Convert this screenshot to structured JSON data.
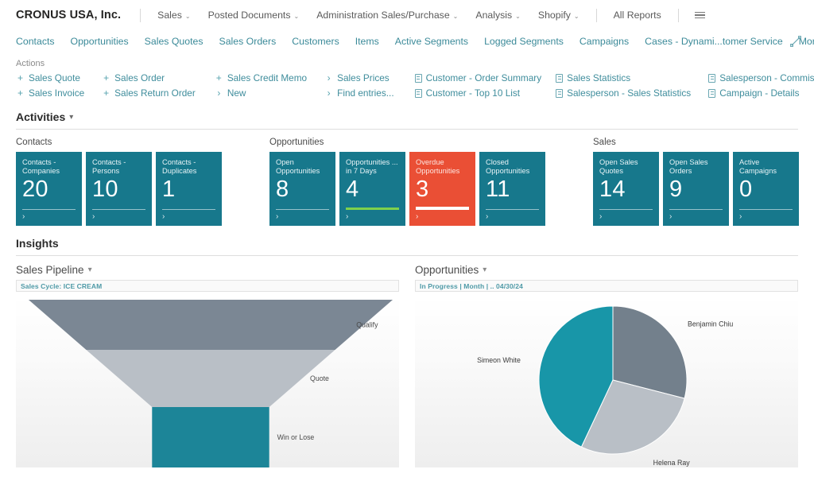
{
  "header": {
    "company": "CRONUS USA, Inc.",
    "nav": [
      {
        "label": "Sales",
        "caret": true
      },
      {
        "label": "Posted Documents",
        "caret": true
      },
      {
        "label": "Administration Sales/Purchase",
        "caret": true
      },
      {
        "label": "Analysis",
        "caret": true
      },
      {
        "label": "Shopify",
        "caret": true
      },
      {
        "label": "All Reports",
        "caret": false
      }
    ],
    "menu_icon": "hamburger-icon",
    "expand_icon": "expand-icon"
  },
  "tabs": [
    {
      "label": "Contacts",
      "caret": false
    },
    {
      "label": "Opportunities",
      "caret": false
    },
    {
      "label": "Sales Quotes",
      "caret": false
    },
    {
      "label": "Sales Orders",
      "caret": false
    },
    {
      "label": "Customers",
      "caret": false
    },
    {
      "label": "Items",
      "caret": false
    },
    {
      "label": "Active Segments",
      "caret": false
    },
    {
      "label": "Logged Segments",
      "caret": false
    },
    {
      "label": "Campaigns",
      "caret": false
    },
    {
      "label": "Cases - Dynami...tomer Service",
      "caret": false
    },
    {
      "label": "More",
      "caret": true
    }
  ],
  "actions": {
    "title": "Actions",
    "columns": [
      [
        {
          "icon": "plus-icon",
          "glyph": "+",
          "label": "Sales Quote"
        },
        {
          "icon": "plus-icon",
          "glyph": "+",
          "label": "Sales Invoice"
        }
      ],
      [
        {
          "icon": "plus-icon",
          "glyph": "+",
          "label": "Sales Order"
        },
        {
          "icon": "plus-icon",
          "glyph": "+",
          "label": "Sales Return Order"
        }
      ],
      [
        {
          "icon": "plus-icon",
          "glyph": "+",
          "label": "Sales Credit Memo"
        },
        {
          "icon": "chevron-right-icon",
          "glyph": "›",
          "label": "New"
        }
      ],
      [
        {
          "icon": "chevron-right-icon",
          "glyph": "›",
          "label": "Sales Prices"
        },
        {
          "icon": "chevron-right-icon",
          "glyph": "›",
          "label": "Find entries..."
        }
      ],
      [
        {
          "icon": "report-icon",
          "glyph": "",
          "label": "Customer - Order Summary"
        },
        {
          "icon": "report-icon",
          "glyph": "",
          "label": "Customer - Top 10 List"
        }
      ],
      [
        {
          "icon": "report-icon",
          "glyph": "",
          "label": "Sales Statistics"
        },
        {
          "icon": "report-icon",
          "glyph": "",
          "label": "Salesperson - Sales Statistics"
        }
      ],
      [
        {
          "icon": "report-icon",
          "glyph": "",
          "label": "Salesperson - Commission"
        },
        {
          "icon": "report-icon",
          "glyph": "",
          "label": "Campaign - Details"
        }
      ]
    ]
  },
  "activities": {
    "title": "Activities",
    "groups": [
      {
        "label": "Contacts",
        "tiles": [
          {
            "caption": "Contacts - Companies",
            "value": "20",
            "style": "teal",
            "bar": "thin"
          },
          {
            "caption": "Contacts - Persons",
            "value": "10",
            "style": "teal",
            "bar": "thin"
          },
          {
            "caption": "Contacts - Duplicates",
            "value": "1",
            "style": "teal",
            "bar": "thin"
          }
        ]
      },
      {
        "label": "Opportunities",
        "tiles": [
          {
            "caption": "Open Opportunities",
            "value": "8",
            "style": "teal",
            "bar": "thin"
          },
          {
            "caption": "Opportunities ... in 7 Days",
            "value": "4",
            "style": "teal",
            "bar": "green"
          },
          {
            "caption": "Overdue Opportunities",
            "value": "3",
            "style": "red",
            "bar": "white"
          },
          {
            "caption": "Closed Opportunities",
            "value": "11",
            "style": "teal",
            "bar": "thin"
          }
        ]
      },
      {
        "label": "Sales",
        "tiles": [
          {
            "caption": "Open Sales Quotes",
            "value": "14",
            "style": "teal",
            "bar": "thin"
          },
          {
            "caption": "Open Sales Orders",
            "value": "9",
            "style": "teal",
            "bar": "thin"
          },
          {
            "caption": "Active Campaigns",
            "value": "0",
            "style": "teal",
            "bar": "thin"
          }
        ]
      }
    ]
  },
  "insights": {
    "title": "Insights",
    "pipeline": {
      "title": "Sales Pipeline",
      "filter": "Sales Cycle: ICE CREAM"
    },
    "opportunities": {
      "title": "Opportunities",
      "filter": "In Progress | Month |  .. 04/30/24"
    }
  },
  "chart_data": [
    {
      "type": "bar",
      "subtype": "funnel",
      "title": "Sales Pipeline",
      "xlabel": "",
      "ylabel": "",
      "categories": [
        "Qualify",
        "Quote",
        "Win or Lose"
      ],
      "values": [
        100,
        62,
        30
      ],
      "colors": [
        "#7b8794",
        "#b9bfc6",
        "#1c8598"
      ],
      "grid": false,
      "legend": "none"
    },
    {
      "type": "pie",
      "title": "Opportunities",
      "labels": [
        "Benjamin Chiu",
        "Helena Ray",
        "Simeon White"
      ],
      "values": [
        29,
        28,
        43
      ],
      "colors": [
        "#73808c",
        "#b9bfc6",
        "#1896a8"
      ],
      "legend": "outside-labels",
      "start_angle": 0
    }
  ]
}
